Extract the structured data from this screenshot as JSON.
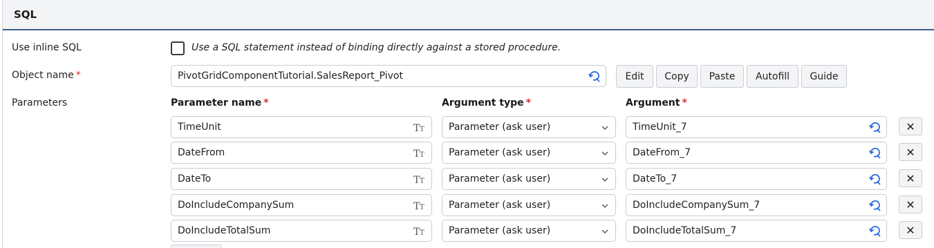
{
  "panel": {
    "title": "SQL"
  },
  "inline_sql": {
    "label": "Use inline SQL",
    "checked": false,
    "description": "Use a SQL statement instead of binding directly against a stored procedure."
  },
  "object_name": {
    "label": "Object name",
    "required_marker": "*",
    "value": "PivotGridComponentTutorial.SalesReport_Pivot",
    "icon": "refresh-select-icon",
    "buttons": [
      "Edit",
      "Copy",
      "Paste",
      "Autofill",
      "Guide"
    ]
  },
  "parameters": {
    "label": "Parameters",
    "columns": {
      "name": "Parameter name",
      "type": "Argument type",
      "argument": "Argument",
      "required_marker": "*"
    },
    "rows": [
      {
        "name": "TimeUnit",
        "type": "Parameter (ask user)",
        "argument": "TimeUnit_7"
      },
      {
        "name": "DateFrom",
        "type": "Parameter (ask user)",
        "argument": "DateFrom_7"
      },
      {
        "name": "DateTo",
        "type": "Parameter (ask user)",
        "argument": "DateTo_7"
      },
      {
        "name": "DoIncludeCompanySum",
        "type": "Parameter (ask user)",
        "argument": "DoIncludeCompanySum_7"
      },
      {
        "name": "DoIncludeTotalSum",
        "type": "Parameter (ask user)",
        "argument": "DoIncludeTotalSum_7"
      }
    ],
    "delete_symbol": "✕"
  },
  "colors": {
    "accent": "#3b5e8c",
    "icon_blue": "#2a6ad8",
    "required": "#d32f2f"
  }
}
